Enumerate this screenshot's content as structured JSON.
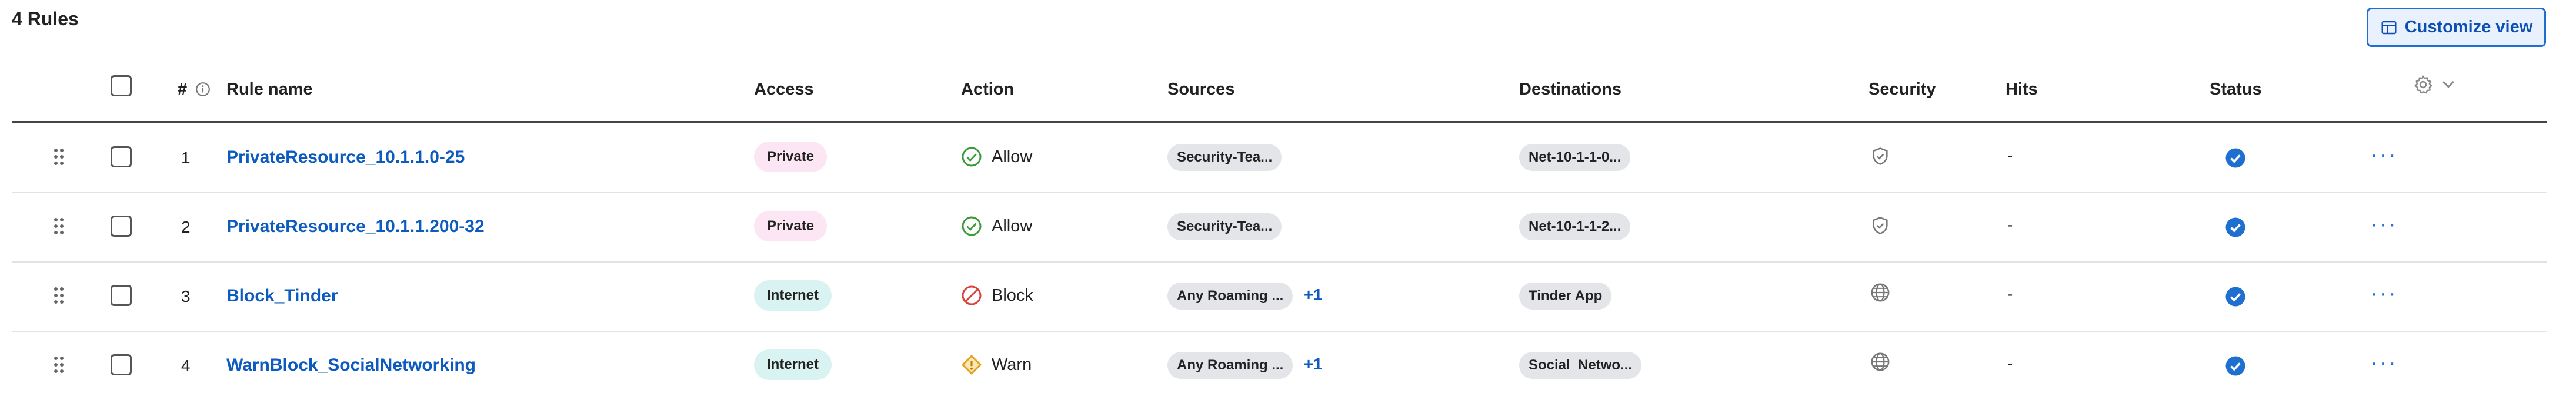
{
  "header": {
    "count_title": "4 Rules",
    "customize_label": "Customize view"
  },
  "columns": {
    "num": "#",
    "rule_name": "Rule name",
    "access": "Access",
    "action": "Action",
    "sources": "Sources",
    "destinations": "Destinations",
    "security": "Security",
    "hits": "Hits",
    "status": "Status"
  },
  "rows": [
    {
      "num": "1",
      "name": "PrivateResource_10.1.1.0-25",
      "access": "Private",
      "access_type": "private",
      "action": "Allow",
      "action_icon": "check-circle-icon",
      "source": "Security-Tea...",
      "source_more": "",
      "destination": "Net-10-1-1-0...",
      "security_icon": "shield-check-icon",
      "hits": "-",
      "status_icon": "check-circle-filled-icon"
    },
    {
      "num": "2",
      "name": "PrivateResource_10.1.1.200-32",
      "access": "Private",
      "access_type": "private",
      "action": "Allow",
      "action_icon": "check-circle-icon",
      "source": "Security-Tea...",
      "source_more": "",
      "destination": "Net-10-1-1-2...",
      "security_icon": "shield-check-icon",
      "hits": "-",
      "status_icon": "check-circle-filled-icon"
    },
    {
      "num": "3",
      "name": "Block_Tinder",
      "access": "Internet",
      "access_type": "internet",
      "action": "Block",
      "action_icon": "block-icon",
      "source": "Any Roaming ...",
      "source_more": "+1",
      "destination": "Tinder App",
      "security_icon": "globe-icon",
      "hits": "-",
      "status_icon": "check-circle-filled-icon"
    },
    {
      "num": "4",
      "name": "WarnBlock_SocialNetworking",
      "access": "Internet",
      "access_type": "internet",
      "action": "Warn",
      "action_icon": "warning-diamond-icon",
      "source": "Any Roaming ...",
      "source_more": "+1",
      "destination": "Social_Netwo...",
      "security_icon": "globe-icon",
      "hits": "-",
      "status_icon": "check-circle-filled-icon"
    }
  ],
  "colors": {
    "accent": "#0d5bbf",
    "allow": "#3a9b3a",
    "block": "#d9423a",
    "warn": "#e3a21a",
    "status": "#1f6fd1"
  }
}
